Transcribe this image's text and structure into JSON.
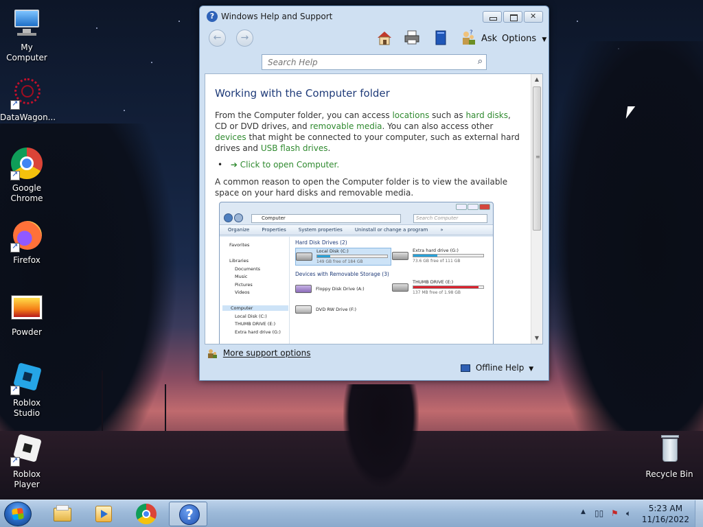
{
  "desktop": {
    "icons": [
      {
        "label": "My Computer"
      },
      {
        "label": "DataWagon..."
      },
      {
        "label": "Google Chrome"
      },
      {
        "label": "Firefox"
      },
      {
        "label": "Powder"
      },
      {
        "label": "Roblox Studio"
      },
      {
        "label": "Roblox Player"
      },
      {
        "label": "Recycle Bin"
      }
    ]
  },
  "window": {
    "title": "Windows Help and Support",
    "toolbar": {
      "ask_label": "Ask",
      "options_label": "Options"
    },
    "search": {
      "placeholder": "Search Help"
    },
    "article": {
      "title": "Working with the Computer folder",
      "p1": {
        "t1": "From the Computer folder, you can access ",
        "l1": "locations",
        "t2": " such as ",
        "l2": "hard disks",
        "t3": ", CD or DVD drives, and ",
        "l3": "removable media",
        "t4": ". You can also access other ",
        "l4": "devices",
        "t5": " that might be connected to your computer, such as external hard drives and ",
        "l5": "USB flash drives",
        "t6": "."
      },
      "link_open": "Click to open Computer.",
      "p2": "A common reason to open the Computer folder is to view the available space on your hard disks and removable media.",
      "screenshot": {
        "address": "Computer",
        "search_placeholder": "Search Computer",
        "toolbar": [
          "Organize",
          "Properties",
          "System properties",
          "Uninstall or change a program",
          "»"
        ],
        "nav": [
          "Favorites",
          "Libraries",
          "Documents",
          "Music",
          "Pictures",
          "Videos",
          "Computer",
          "Local Disk (C:)",
          "THUMB DRIVE (E:)",
          "Extra hard drive (G:)"
        ],
        "group_hdd": "Hard Disk Drives (2)",
        "group_removable": "Devices with Removable Storage (3)",
        "drives": [
          {
            "name": "Local Disk (C:)",
            "free": "149 GB free of 184 GB",
            "used_fraction": 0.19
          },
          {
            "name": "Extra hard drive (G:)",
            "free": "73.6 GB free of 111 GB",
            "used_fraction": 0.34
          },
          {
            "name": "Floppy Disk Drive (A:)"
          },
          {
            "name": "THUMB DRIVE (E:)",
            "free": "137 MB free of 1.98 GB",
            "used_fraction": 0.93
          },
          {
            "name": "DVD RW Drive (F:)"
          }
        ]
      }
    },
    "footer": {
      "more_support": "More support options",
      "offline_help": "Offline Help"
    }
  },
  "taskbar": {
    "clock_time": "5:23 AM",
    "clock_date": "11/16/2022"
  }
}
